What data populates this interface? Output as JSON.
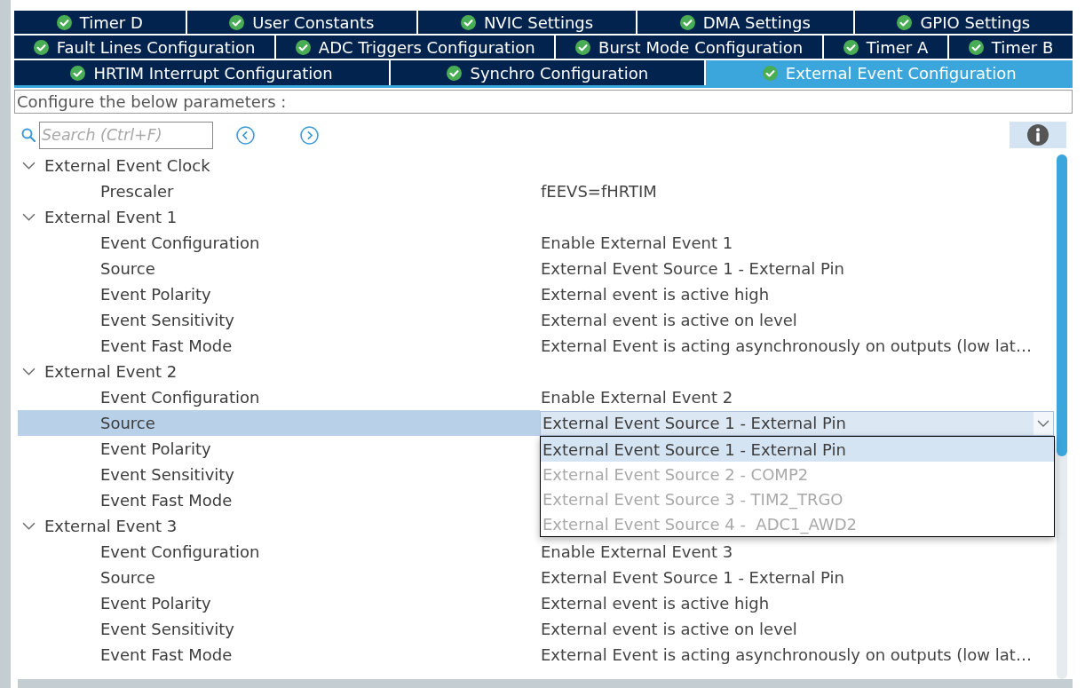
{
  "tab_rows": [
    {
      "tabs": [
        {
          "label": "Timer D",
          "selected": false
        },
        {
          "label": "User Constants",
          "selected": false
        },
        {
          "label": "NVIC Settings",
          "selected": false
        },
        {
          "label": "DMA Settings",
          "selected": false
        },
        {
          "label": "GPIO Settings",
          "selected": false
        }
      ]
    },
    {
      "tabs": [
        {
          "label": "Fault Lines Configuration",
          "selected": false
        },
        {
          "label": "ADC Triggers Configuration",
          "selected": false
        },
        {
          "label": "Burst Mode Configuration",
          "selected": false
        },
        {
          "label": "Timer A",
          "selected": false
        },
        {
          "label": "Timer B",
          "selected": false
        }
      ]
    },
    {
      "tabs": [
        {
          "label": "HRTIM Interrupt Configuration",
          "selected": false
        },
        {
          "label": "Synchro Configuration",
          "selected": false
        },
        {
          "label": "External Event Configuration",
          "selected": true
        }
      ]
    }
  ],
  "description": "Configure the below parameters :",
  "search": {
    "placeholder": "Search (Ctrl+F)"
  },
  "tree": [
    {
      "label": "External Event Clock",
      "expanded": true,
      "selected": false,
      "children": [
        {
          "label": "Prescaler",
          "value": "fEEVS=fHRTIM",
          "selected": false
        }
      ]
    },
    {
      "label": "External Event 1",
      "expanded": true,
      "selected": false,
      "children": [
        {
          "label": "Event Configuration",
          "value": "Enable External Event 1",
          "selected": false
        },
        {
          "label": "Source",
          "value": "External Event Source 1 - External Pin",
          "selected": false
        },
        {
          "label": "Event Polarity",
          "value": "External event is active high",
          "selected": false
        },
        {
          "label": "Event Sensitivity",
          "value": "External event is active on level",
          "selected": false
        },
        {
          "label": "Event Fast Mode",
          "value": "External Event is acting asynchronously on outputs (low lat…",
          "selected": false
        }
      ]
    },
    {
      "label": "External Event 2",
      "expanded": true,
      "selected": false,
      "children": [
        {
          "label": "Event Configuration",
          "value": "Enable External Event 2",
          "selected": false
        },
        {
          "label": "Source",
          "value": "External Event Source 1 - External Pin",
          "selected": true,
          "open": true,
          "options": [
            {
              "label": "External Event Source 1 - External Pin",
              "selected": true,
              "disabled": false
            },
            {
              "label": "External Event Source 2 - COMP2",
              "selected": false,
              "disabled": true
            },
            {
              "label": "External Event Source 3 - TIM2_TRGO",
              "selected": false,
              "disabled": true
            },
            {
              "label": "External Event Source 4 -  ADC1_AWD2",
              "selected": false,
              "disabled": true
            }
          ]
        },
        {
          "label": "Event Polarity",
          "selected": false
        },
        {
          "label": "Event Sensitivity",
          "selected": false
        },
        {
          "label": "Event Fast Mode",
          "selected": false
        }
      ]
    },
    {
      "label": "External Event 3",
      "expanded": true,
      "selected": false,
      "children": [
        {
          "label": "Event Configuration",
          "value": "Enable External Event 3",
          "selected": false
        },
        {
          "label": "Source",
          "value": "External Event Source 1 - External Pin",
          "selected": false
        },
        {
          "label": "Event Polarity",
          "value": "External event is active high",
          "selected": false
        },
        {
          "label": "Event Sensitivity",
          "value": "External event is active on level",
          "selected": false
        },
        {
          "label": "Event Fast Mode",
          "value": "External Event is acting asynchronously on outputs (low lat…",
          "selected": false
        }
      ]
    }
  ]
}
